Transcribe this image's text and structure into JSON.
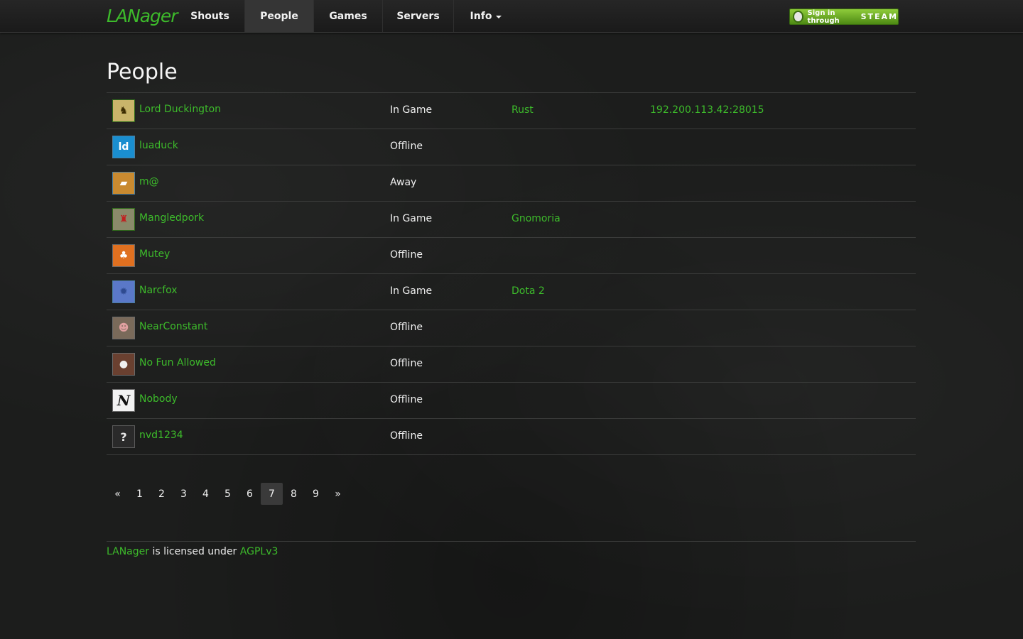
{
  "brand": "LANager",
  "nav": {
    "items": [
      {
        "label": "Shouts",
        "active": false
      },
      {
        "label": "People",
        "active": true
      },
      {
        "label": "Games",
        "active": false
      },
      {
        "label": "Servers",
        "active": false
      },
      {
        "label": "Info",
        "active": false,
        "dropdown": true
      }
    ],
    "steam_small": "Sign in through",
    "steam_big": "STEAM"
  },
  "page_title": "People",
  "people": [
    {
      "name": "Lord Duckington",
      "status": "In Game",
      "game": "Rust",
      "server": "192.200.113.42:28015",
      "avatar_icon": "rubber-duck-avatar"
    },
    {
      "name": "luaduck",
      "status": "Offline",
      "game": "",
      "server": "",
      "avatar_icon": "ld-logo-avatar"
    },
    {
      "name": "m@",
      "status": "Away",
      "game": "",
      "server": "",
      "avatar_icon": "bread-avatar"
    },
    {
      "name": "Mangledpork",
      "status": "In Game",
      "game": "Gnomoria",
      "server": "",
      "avatar_icon": "red-figure-avatar"
    },
    {
      "name": "Mutey",
      "status": "Offline",
      "game": "",
      "server": "",
      "avatar_icon": "mushroom-avatar"
    },
    {
      "name": "Narcfox",
      "status": "In Game",
      "game": "Dota 2",
      "server": "",
      "avatar_icon": "gear-avatar"
    },
    {
      "name": "NearConstant",
      "status": "Offline",
      "game": "",
      "server": "",
      "avatar_icon": "pink-creature-avatar"
    },
    {
      "name": "No Fun Allowed",
      "status": "Offline",
      "game": "",
      "server": "",
      "avatar_icon": "goomba-avatar"
    },
    {
      "name": "Nobody",
      "status": "Offline",
      "game": "",
      "server": "",
      "avatar_icon": "gothic-n-avatar"
    },
    {
      "name": "nvd1234",
      "status": "Offline",
      "game": "",
      "server": "",
      "avatar_icon": "question-mark-avatar"
    }
  ],
  "pagination": {
    "prev": "«",
    "pages": [
      "1",
      "2",
      "3",
      "4",
      "5",
      "6",
      "7",
      "8",
      "9"
    ],
    "current": "7",
    "next": "»"
  },
  "footer": {
    "project": "LANager",
    "text": "is licensed under",
    "license": "AGPLv3"
  },
  "colors": {
    "accent": "#3dbb2b",
    "background": "#1c1d1c",
    "steam_button": "#6ea62a"
  }
}
